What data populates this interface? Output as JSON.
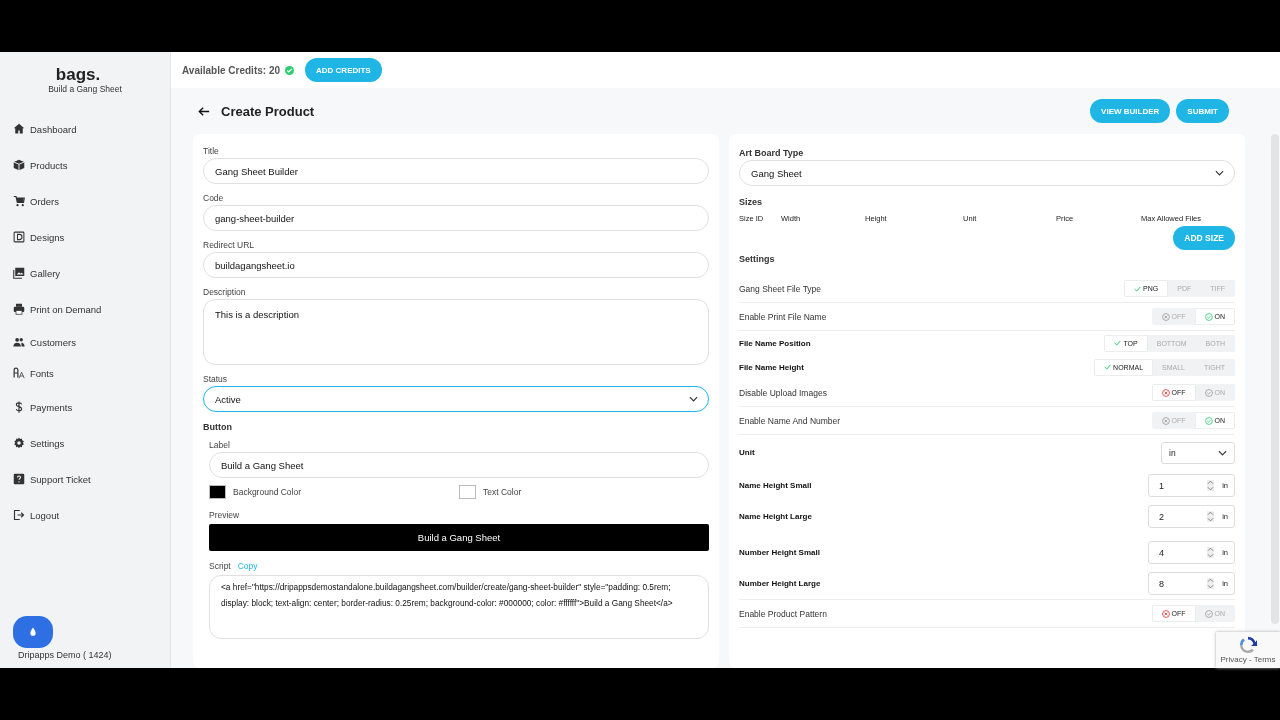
{
  "brand": {
    "logo": "bags.",
    "tagline": "Build a Gang Sheet"
  },
  "sidebar": {
    "items": [
      {
        "label": "Dashboard"
      },
      {
        "label": "Products"
      },
      {
        "label": "Orders"
      },
      {
        "label": "Designs"
      },
      {
        "label": "Gallery"
      },
      {
        "label": "Print on Demand"
      },
      {
        "label": "Customers"
      },
      {
        "label": "Fonts"
      },
      {
        "label": "Payments"
      },
      {
        "label": "Settings"
      },
      {
        "label": "Support Ticket"
      },
      {
        "label": "Logout"
      }
    ],
    "footer": "Dripapps Demo ( 1424)"
  },
  "topbar": {
    "credits": "Available Credits: 20",
    "button": "ADD CREDITS"
  },
  "page": {
    "title": "Create Product",
    "buttons": [
      "VIEW BUILDER",
      "SUBMIT"
    ]
  },
  "form": {
    "fields": [
      {
        "kind": "input",
        "label": "Title",
        "value": "Gang Sheet Builder"
      },
      {
        "kind": "input",
        "label": "Code",
        "value": "gang-sheet-builder"
      },
      {
        "kind": "input",
        "label": "Redirect URL",
        "value": "buildagangsheet.io"
      },
      {
        "kind": "textarea",
        "label": "Description",
        "value": "This is a description"
      },
      {
        "kind": "select",
        "label": "Status",
        "value": "Active",
        "focused": true
      }
    ],
    "button_section": {
      "heading": "Button",
      "label_field": {
        "label": "Label",
        "value": "Build a Gang Sheet"
      },
      "colors": [
        {
          "label": "Background Color",
          "color": "#000000"
        },
        {
          "label": "Text Color",
          "color": "#ffffff"
        }
      ],
      "preview_label": "Preview",
      "preview_text": "Build a Gang Sheet",
      "script_label": "Script",
      "copy_link": "Copy",
      "script": "<a href=\"https://dripappsdemostandalone.buildagangsheet.com/builder/create/gang-sheet-builder\" style=\"padding: 0.5rem; display: block; text-align: center; border-radius: 0.25rem; background-color: #000000; color: #ffffff\">Build a Gang Sheet</a>"
    }
  },
  "artboard": {
    "label": "Art Board Type",
    "value": "Gang Sheet"
  },
  "sizes": {
    "heading": "Sizes",
    "columns": [
      "Size ID",
      "Width",
      "Height",
      "Unit",
      "Price",
      "Max Allowed Files"
    ],
    "button": "ADD SIZE"
  },
  "settings": {
    "heading": "Settings",
    "rows": [
      {
        "kind": "segmented",
        "label": "Gang Sheet File Type",
        "bold": false,
        "options": [
          {
            "label": "PNG",
            "selected": true
          },
          {
            "label": "PDF",
            "selected": false
          },
          {
            "label": "TIFF",
            "selected": false
          }
        ]
      },
      {
        "kind": "toggle",
        "label": "Enable Print File Name",
        "bold": false,
        "on": true,
        "off_label": "OFF",
        "on_label": "ON"
      },
      {
        "kind": "segmented",
        "label": "File Name Position",
        "bold": true,
        "options": [
          {
            "label": "TOP",
            "selected": true
          },
          {
            "label": "BOTTOM",
            "selected": false
          },
          {
            "label": "BOTH",
            "selected": false
          }
        ]
      },
      {
        "kind": "segmented",
        "label": "File Name Height",
        "bold": true,
        "options": [
          {
            "label": "NORMAL",
            "selected": true
          },
          {
            "label": "SMALL",
            "selected": false
          },
          {
            "label": "TIGHT",
            "selected": false
          }
        ]
      },
      {
        "kind": "toggle",
        "label": "Disable Upload Images",
        "bold": false,
        "on": false,
        "off_label": "OFF",
        "on_label": "ON"
      },
      {
        "kind": "toggle",
        "label": "Enable Name And Number",
        "bold": false,
        "on": true,
        "off_label": "OFF",
        "on_label": "ON"
      },
      {
        "kind": "select",
        "label": "Unit",
        "bold": true,
        "value": "in"
      },
      {
        "kind": "number",
        "label": "Name Height Small",
        "bold": true,
        "value": "1",
        "unit": "in"
      },
      {
        "kind": "number",
        "label": "Name Height Large",
        "bold": true,
        "value": "2",
        "unit": "in"
      },
      {
        "kind": "number",
        "label": "Number Height Small",
        "bold": true,
        "value": "4",
        "unit": "in"
      },
      {
        "kind": "number",
        "label": "Number Height Large",
        "bold": true,
        "value": "8",
        "unit": "in"
      },
      {
        "kind": "toggle",
        "label": "Enable Product Pattern",
        "bold": false,
        "on": false,
        "off_label": "OFF",
        "on_label": "ON"
      }
    ]
  },
  "recaptcha": {
    "text": "Privacy - Terms"
  }
}
